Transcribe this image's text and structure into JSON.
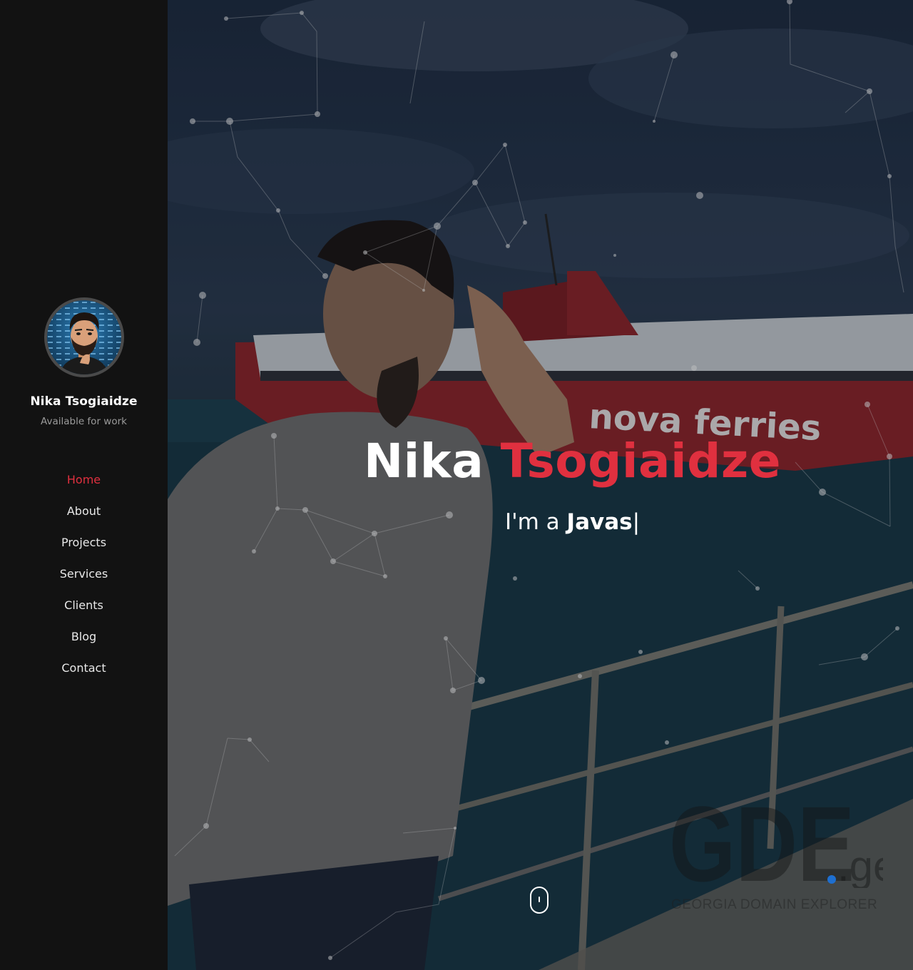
{
  "sidebar": {
    "profile": {
      "name": "Nika Tsogiaidze",
      "status": "Available for work"
    },
    "nav": [
      {
        "label": "Home",
        "active": true
      },
      {
        "label": "About"
      },
      {
        "label": "Projects"
      },
      {
        "label": "Services"
      },
      {
        "label": "Clients"
      },
      {
        "label": "Blog"
      },
      {
        "label": "Contact"
      }
    ]
  },
  "hero": {
    "title_first": "Nika",
    "title_last": "Tsogiaidze",
    "typed_prefix": "I'm a",
    "typed_word": "Javas",
    "typed_cursor": "|",
    "photo_text": "nova   ferries",
    "watermark": {
      "logo": "GDE",
      "tld": ".ge",
      "tagline": "GEORGIA DOMAIN EXPLORER"
    }
  },
  "colors": {
    "accent": "#e0303f",
    "sidebar_bg": "#121212",
    "text": "#ffffff"
  },
  "icons": {
    "scroll": "mouse-scroll-icon"
  }
}
